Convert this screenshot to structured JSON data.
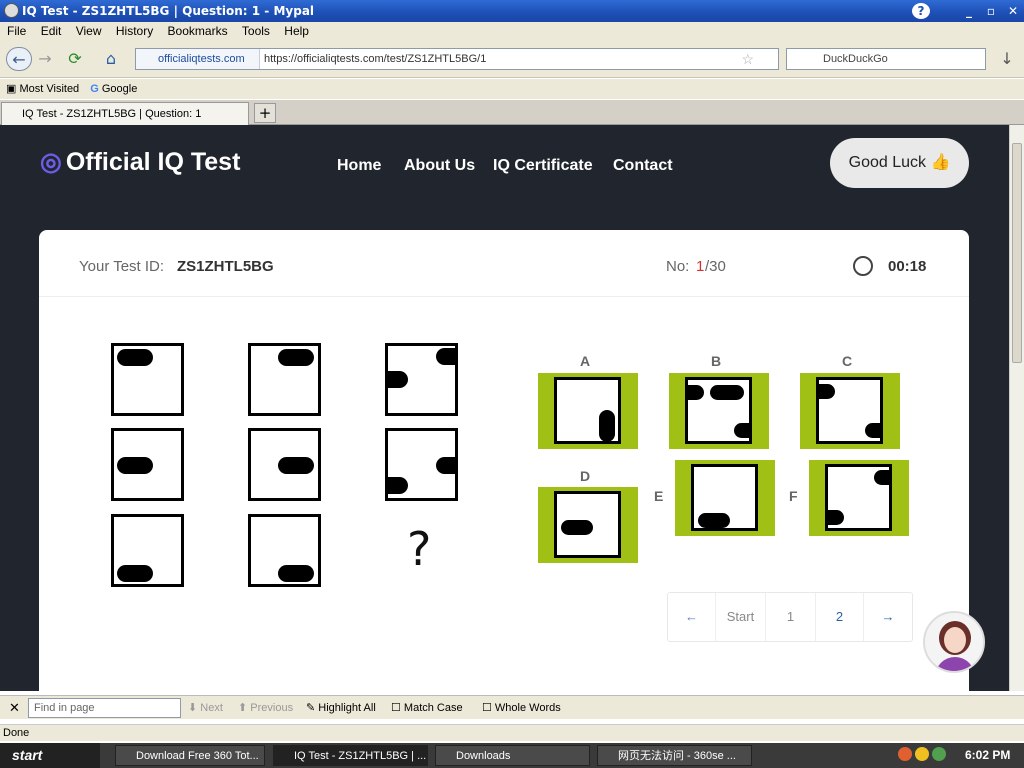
{
  "window": {
    "title": "IQ Test - ZS1ZHTL5BG | Question: 1 - Mypal"
  },
  "menu": [
    "File",
    "Edit",
    "View",
    "History",
    "Bookmarks",
    "Tools",
    "Help"
  ],
  "nav": {
    "site": "officialiqtests.com",
    "url": "https://officialiqtests.com/test/ZS1ZHTL5BG/1",
    "search_placeholder": "DuckDuckGo"
  },
  "bookmarks": [
    "Most Visited",
    "Google"
  ],
  "tab": {
    "label": "IQ Test - ZS1ZHTL5BG | Question: 1",
    "new": "+"
  },
  "site": {
    "logo": "Official IQ Test",
    "menu": [
      "Home",
      "About Us",
      "IQ Certificate",
      "Contact"
    ],
    "good_luck": "Good Luck 👍"
  },
  "test": {
    "id_label": "Your Test ID:",
    "id": "ZS1ZHTL5BG",
    "no_label": "No:",
    "no_current": "1",
    "no_total": "/30",
    "timer": "00:18",
    "question_mark": "?",
    "options": [
      "A",
      "B",
      "C",
      "D",
      "E",
      "F"
    ]
  },
  "pager": {
    "prev": "←",
    "start": "Start",
    "p1": "1",
    "p2": "2",
    "next": "→"
  },
  "find": {
    "placeholder": "Find in page",
    "next": "Next",
    "previous": "Previous",
    "highlight": "Highlight All",
    "match_case": "Match Case",
    "whole_words": "Whole Words"
  },
  "status": "Done",
  "taskbar": {
    "start": "start",
    "items": [
      "Download Free 360 Tot...",
      "IQ Test - ZS1ZHTL5BG | ...",
      "Downloads",
      "网页无法访问 - 360se ..."
    ],
    "clock": "6:02 PM"
  },
  "colors": {
    "page_bg": "#21262e",
    "option_bg": "#a0c016",
    "accent": "#6c5ce7"
  }
}
